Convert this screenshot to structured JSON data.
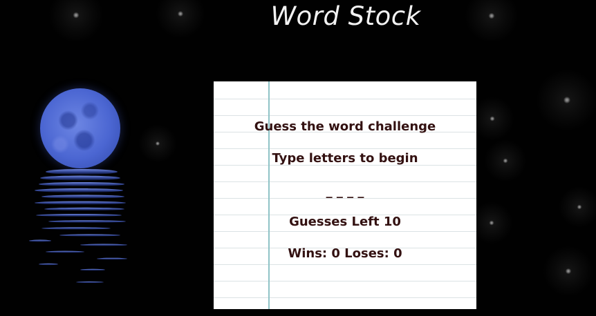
{
  "header": {
    "title": "Word Stock"
  },
  "game": {
    "challenge_title": "Guess the word challenge",
    "instruction": "Type letters to begin",
    "word_display": "_ _ _ _",
    "guesses_left": "Guesses Left 10",
    "score": "Wins: 0 Loses: 0"
  },
  "colors": {
    "background": "#010101",
    "card": "#ffffff",
    "card_text": "#331111",
    "margin_line": "#8fc3c6",
    "moon": "#4b66d2"
  },
  "decor": {
    "moon_icon": "full-moon-icon",
    "reflection_icon": "water-reflection-icon"
  }
}
